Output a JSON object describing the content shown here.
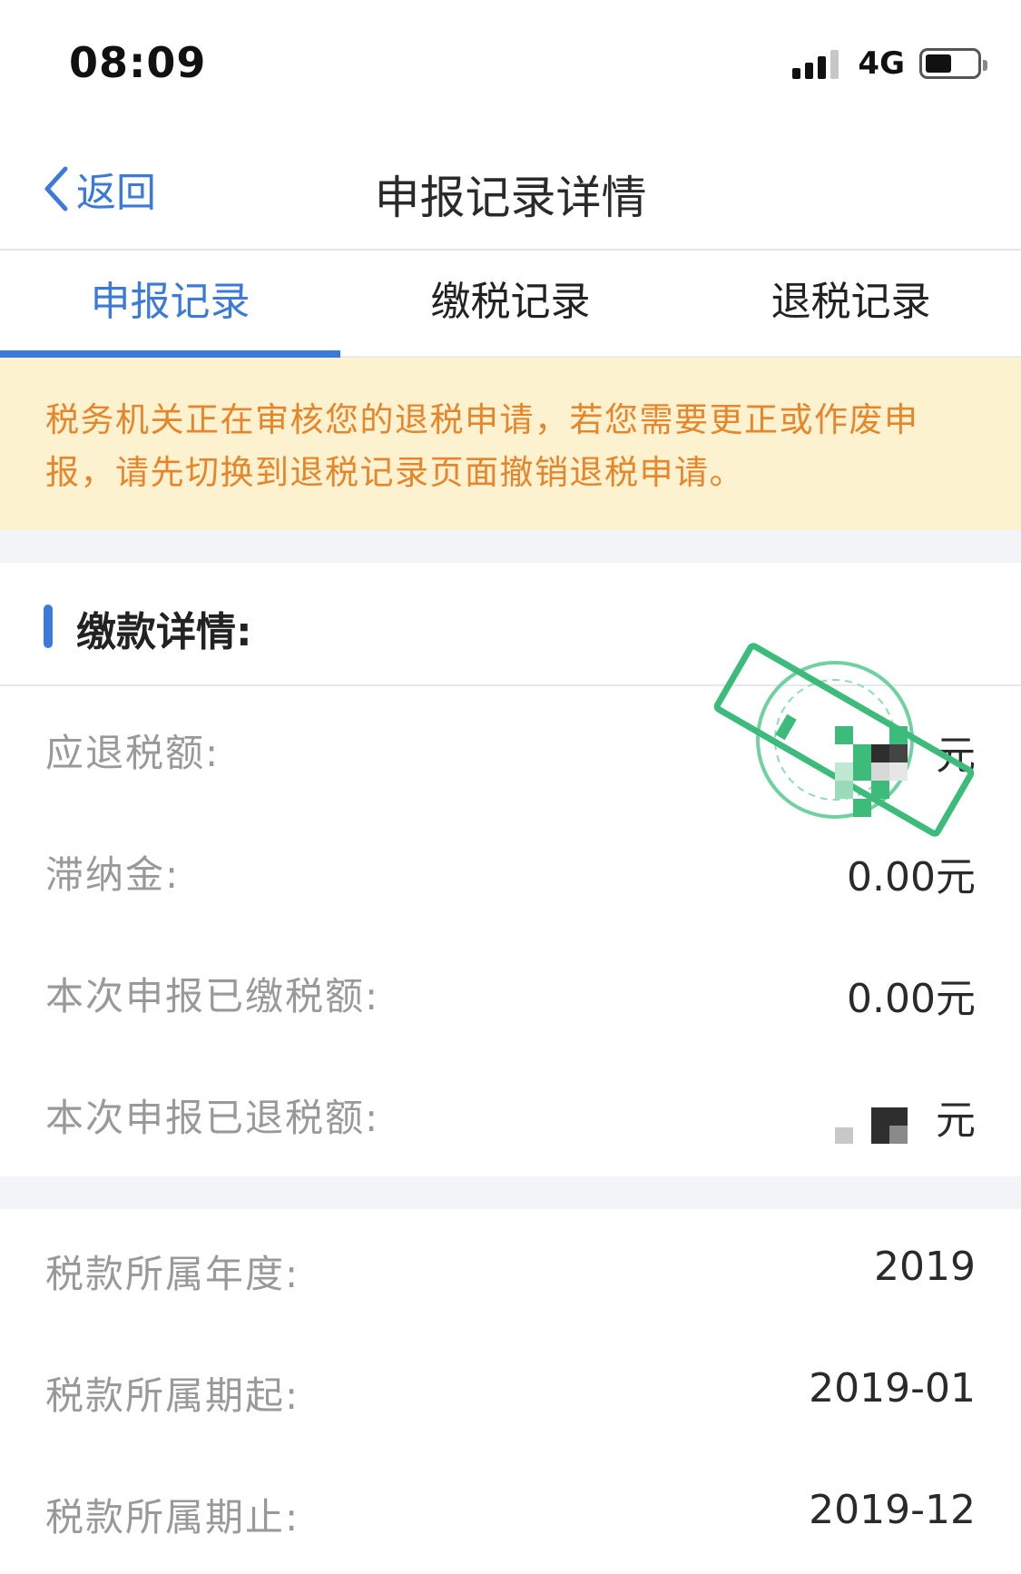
{
  "status_bar": {
    "time": "08:09",
    "network": "4G"
  },
  "nav": {
    "back_label": "返回",
    "title": "申报记录详情"
  },
  "tabs": [
    {
      "label": "申报记录",
      "active": true
    },
    {
      "label": "缴税记录",
      "active": false
    },
    {
      "label": "退税记录",
      "active": false
    }
  ],
  "notice": {
    "text": "税务机关正在审核您的退税申请，若您需要更正或作废申报，请先切换到退税记录页面撤销退税申请。"
  },
  "payment_section": {
    "title": "缴款详情:",
    "rows": [
      {
        "label": "应退税额:",
        "value": "元"
      },
      {
        "label": "滞纳金:",
        "value": "0.00元"
      },
      {
        "label": "本次申报已缴税额:",
        "value": "0.00元"
      },
      {
        "label": "本次申报已退税额:",
        "value": "元"
      }
    ]
  },
  "period_section": {
    "rows": [
      {
        "label": "税款所属年度:",
        "value": "2019"
      },
      {
        "label": "税款所属期起:",
        "value": "2019-01"
      },
      {
        "label": "税款所属期止:",
        "value": "2019-12"
      }
    ]
  },
  "colors": {
    "accent": "#3b7ad8",
    "notice_bg": "#fdf2d0",
    "notice_text": "#e6852a",
    "stamp": "#3dbb7a"
  }
}
